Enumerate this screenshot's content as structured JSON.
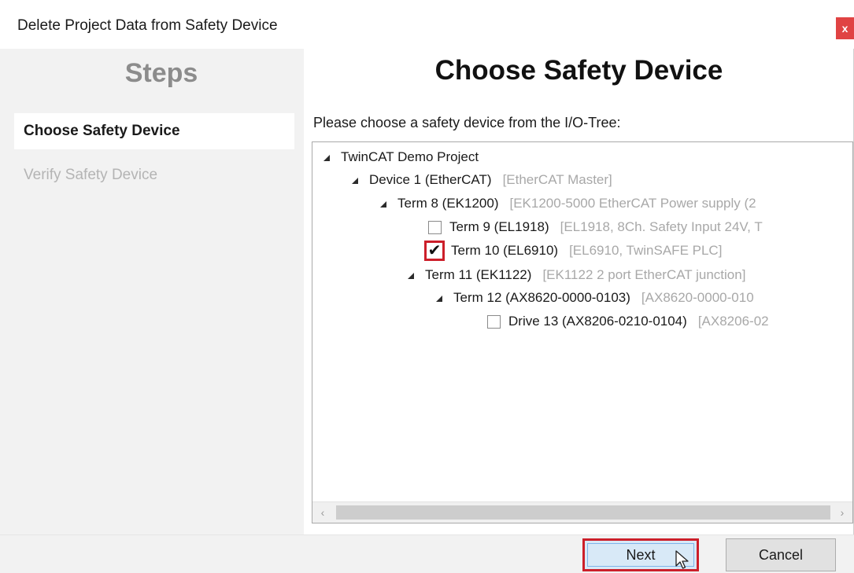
{
  "window": {
    "title": "Delete Project Data from Safety Device",
    "close_glyph": "x"
  },
  "steps": {
    "heading": "Steps",
    "items": [
      {
        "label": "Choose Safety Device",
        "state": "active"
      },
      {
        "label": "Verify Safety Device",
        "state": "inactive"
      }
    ]
  },
  "main": {
    "heading": "Choose Safety Device",
    "instruction": "Please choose a safety device from the I/O-Tree:"
  },
  "tree": {
    "nodes": [
      {
        "label": "TwinCAT Demo Project",
        "desc": "",
        "expander": true,
        "checkbox": null
      },
      {
        "label": "Device 1 (EtherCAT)",
        "desc": "[EtherCAT Master]",
        "expander": true,
        "checkbox": null
      },
      {
        "label": "Term 8 (EK1200)",
        "desc": "[EK1200-5000 EtherCAT Power supply (2",
        "expander": true,
        "checkbox": null
      },
      {
        "label": "Term 9 (EL1918)",
        "desc": "[EL1918, 8Ch. Safety Input 24V, T",
        "expander": false,
        "checkbox": "unchecked"
      },
      {
        "label": "Term 10 (EL6910)",
        "desc": "[EL6910, TwinSAFE PLC]",
        "expander": false,
        "checkbox": "checked"
      },
      {
        "label": "Term 11 (EK1122)",
        "desc": "[EK1122 2 port EtherCAT junction]",
        "expander": true,
        "checkbox": null
      },
      {
        "label": "Term 12 (AX8620-0000-0103)",
        "desc": "[AX8620-0000-010",
        "expander": true,
        "checkbox": null
      },
      {
        "label": "Drive 13 (AX8206-0210-0104)",
        "desc": "[AX8206-02",
        "expander": false,
        "checkbox": "unchecked"
      }
    ],
    "scroll_left_glyph": "‹",
    "scroll_right_glyph": "›"
  },
  "footer": {
    "next_label": "Next",
    "cancel_label": "Cancel"
  },
  "colors": {
    "highlight_red": "#cc1f2a",
    "close_red": "#e04343",
    "next_bg": "#d8e9f7"
  },
  "icons": {
    "expander": "expand-triangle-icon",
    "close": "close-icon",
    "cursor": "mouse-pointer-icon"
  }
}
